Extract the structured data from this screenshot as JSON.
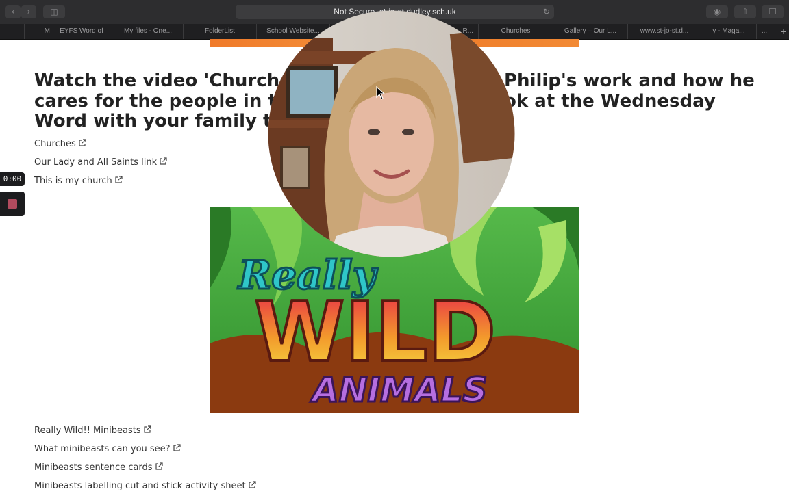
{
  "browser": {
    "address_prefix": "Not Secure",
    "address_host": "st-jo-st.dudley.sch.uk",
    "tabs": [
      {
        "label": "M"
      },
      {
        "label": "EYFS Word of"
      },
      {
        "label": "My files - One..."
      },
      {
        "label": "FolderList"
      },
      {
        "label": "School Website..."
      },
      {
        "label": "R..."
      },
      {
        "label": "Churches"
      },
      {
        "label": "Gallery – Our L..."
      },
      {
        "label": "www.st-jo-st.d..."
      },
      {
        "label": "y - Maga..."
      },
      {
        "label": "..."
      }
    ]
  },
  "page": {
    "heading": "Watch the video 'Churches' ... Philip's work and how he cares for the people in the ... ok at the Wednesday Word with your family too",
    "heading_lines": [
      {
        "left": "Watch the video 'Churches'",
        "right": "Philip's work and how he"
      },
      {
        "left": "cares for the people in the",
        "right": "ok at the Wednesday"
      },
      {
        "left": "Word with your family too",
        "right": ""
      }
    ],
    "links_top": [
      {
        "label": "Churches"
      },
      {
        "label": "Our Lady and All Saints link"
      },
      {
        "label": "This is my church"
      }
    ],
    "links_bottom": [
      {
        "label": "Really Wild!! Minibeasts"
      },
      {
        "label": "What minibeasts can you see?"
      },
      {
        "label": "Minibeasts sentence cards"
      },
      {
        "label": "Minibeasts labelling cut and stick activity sheet"
      }
    ],
    "image_title_top": "Really",
    "image_title_middle": "WILD",
    "image_title_bottom": "ANIMALS"
  },
  "recording": {
    "timer": "0:00",
    "colors": {
      "stop": "#b24b5e"
    }
  },
  "colors": {
    "banner": "#f07a2a",
    "jungle_green": "#3fa33a",
    "ground_brown": "#8b3a10"
  }
}
